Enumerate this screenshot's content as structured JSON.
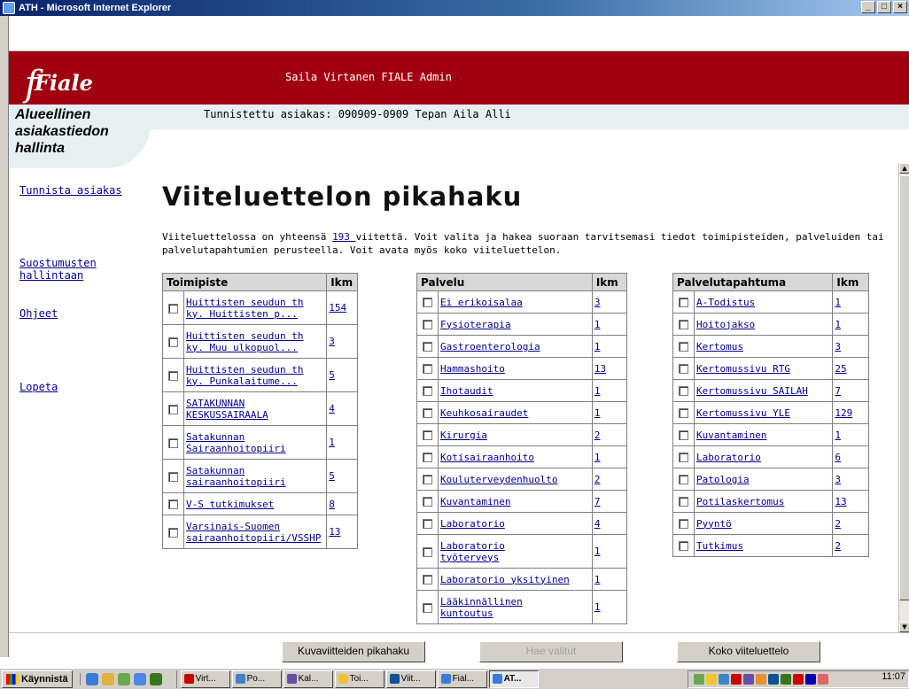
{
  "window": {
    "title": "ATH - Microsoft Internet Explorer",
    "min": "_",
    "max": "□",
    "close": "×"
  },
  "header": {
    "logo_initial": "f",
    "logo_text": "Fiale",
    "admin_name": "Saila Virtanen FIALE Admin",
    "customer_id": "Tunnistettu asiakas: 090909-0909 Tepan Aila Alli",
    "brand_color": "#a0000f"
  },
  "app_title": {
    "line1": "Alueellinen",
    "line2": "asiakastiedon",
    "line3": "hallinta"
  },
  "nav": {
    "identify": "Tunnista asiakas",
    "consent1": "Suostumusten",
    "consent2": "hallintaan",
    "help": "Ohjeet",
    "logout": "Lopeta"
  },
  "main": {
    "title": "Viiteluettelon pikahaku",
    "intro_before": "Viiteluettelossa on yhteensä ",
    "intro_count": "193 ",
    "intro_after": "viitettä. Voit valita ja hakea suoraan tarvitsemasi tiedot toimipisteiden, palveluiden tai palvelutapahtumien perusteella. Voit avata myös koko viiteluettelon."
  },
  "toimipiste": {
    "header": "Toimipiste",
    "count_header": "Ikm",
    "rows": [
      {
        "l1": "Huittisten seudun th",
        "l2": "ky. Huittisten p...",
        "n": "154"
      },
      {
        "l1": "Huittisten seudun th",
        "l2": "ky. Muu ulkopuol...",
        "n": "3"
      },
      {
        "l1": "Huittisten seudun th",
        "l2": "ky. Punkalaitume...",
        "n": "5"
      },
      {
        "l1": "SATAKUNNAN",
        "l2": "KESKUSSAIRAALA",
        "n": "4"
      },
      {
        "l1": "Satakunnan",
        "l2": "Sairaanhoitopiiri",
        "n": "1"
      },
      {
        "l1": "Satakunnan",
        "l2": "sairaanhoitopiiri",
        "n": "5"
      },
      {
        "l1": "V-S tutkimukset",
        "l2": "",
        "n": "8"
      },
      {
        "l1": "Varsinais-Suomen",
        "l2": "sairaanhoitopiiri/VSSHP",
        "n": "13"
      }
    ]
  },
  "palvelu": {
    "header": "Palvelu",
    "count_header": "Ikm",
    "rows": [
      {
        "l1": "Ei erikoisalaa",
        "l2": "",
        "n": "3"
      },
      {
        "l1": "Fysioterapia",
        "l2": "",
        "n": "1"
      },
      {
        "l1": "Gastroenterologia",
        "l2": "",
        "n": "1"
      },
      {
        "l1": "Hammashoito",
        "l2": "",
        "n": "13"
      },
      {
        "l1": "Ihotaudit",
        "l2": "",
        "n": "1"
      },
      {
        "l1": "Keuhkosairaudet",
        "l2": "",
        "n": "1"
      },
      {
        "l1": "Kirurgia",
        "l2": "",
        "n": "2"
      },
      {
        "l1": "Kotisairaanhoito",
        "l2": "",
        "n": "1"
      },
      {
        "l1": "Kouluterveydenhuolto",
        "l2": "",
        "n": "2"
      },
      {
        "l1": "Kuvantaminen",
        "l2": "",
        "n": "7"
      },
      {
        "l1": "Laboratorio",
        "l2": "",
        "n": "4"
      },
      {
        "l1": "Laboratorio",
        "l2": "työterveys",
        "n": "1"
      },
      {
        "l1": "Laboratorio yksityinen",
        "l2": "",
        "n": "1"
      },
      {
        "l1": "Lääkinnällinen",
        "l2": "kuntoutus",
        "n": "1"
      }
    ]
  },
  "palvelutapahtuma": {
    "header": "Palvelutapahtuma",
    "count_header": "Ikm",
    "rows": [
      {
        "l1": "A-Todistus",
        "l2": "",
        "n": "1"
      },
      {
        "l1": "Hoitojakso",
        "l2": "",
        "n": "1"
      },
      {
        "l1": "Kertomus",
        "l2": "",
        "n": "3"
      },
      {
        "l1": "Kertomussivu RTG",
        "l2": "",
        "n": "25"
      },
      {
        "l1": "Kertomussivu SAILAH",
        "l2": "",
        "n": "7"
      },
      {
        "l1": "Kertomussivu YLE",
        "l2": "",
        "n": "129"
      },
      {
        "l1": "Kuvantaminen",
        "l2": "",
        "n": "1"
      },
      {
        "l1": "Laboratorio",
        "l2": "",
        "n": "6"
      },
      {
        "l1": "Patologia",
        "l2": "",
        "n": "3"
      },
      {
        "l1": "Potilaskertomus",
        "l2": "",
        "n": "13"
      },
      {
        "l1": "Pyyntö",
        "l2": "",
        "n": "2"
      },
      {
        "l1": "Tutkimus",
        "l2": "",
        "n": "2"
      }
    ]
  },
  "buttons": {
    "image_search": "Kuvaviitteiden pikahaku",
    "fetch_selected": "Hae valitut",
    "full_list": "Koko viiteluettelo"
  },
  "taskbar": {
    "start": "Käynnistä",
    "tasks": [
      "Virt...",
      "Po...",
      "Kal...",
      "Toi...",
      "Viit...",
      "Fial...",
      "AT..."
    ],
    "clock": "11:07"
  }
}
